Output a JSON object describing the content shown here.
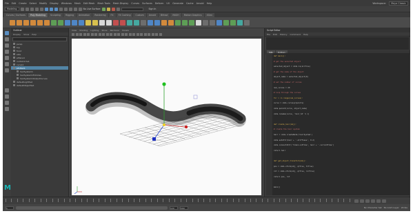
{
  "colors": {
    "app_bg": "#444444",
    "selection": "#5285a6",
    "accent_blue": "#5a8ec2",
    "code_def": "#d8b04e",
    "code_comment": "#c26a6a",
    "maya_logo": "#19b5b5"
  },
  "menubar": {
    "items": [
      "File",
      "Edit",
      "Create",
      "Select",
      "Modify",
      "Display",
      "Windows",
      "Mesh",
      "Edit Mesh",
      "Mesh Tools",
      "Mesh Display",
      "Curves",
      "Surfaces",
      "Deform",
      "UV",
      "Generate",
      "Cache",
      "Arnold",
      "Help"
    ],
    "workspace_label": "Workspace:",
    "workspace_value": "Maya Classic"
  },
  "statusline": {
    "mode": "Modeling",
    "no_live_surface": "No Live Surface",
    "sign_in": "Sign In"
  },
  "shelf_tabs": [
    "Curves / Surfaces",
    "Poly Modeling",
    "Sculpting",
    "Rigging",
    "Animation",
    "Rendering",
    "FX",
    "FX Caching",
    "Custom",
    "Arnold",
    "Bifrost",
    "MASH",
    "Motion Graphics",
    "XGen"
  ],
  "shelf_active_index": 1,
  "toolbox_icons": [
    "select-tool",
    "lasso-tool",
    "paint-select-tool",
    "move-tool",
    "rotate-tool",
    "scale-tool",
    "last-tool"
  ],
  "outliner": {
    "title": "Outliner",
    "menu": [
      "Display",
      "Show",
      "Help"
    ],
    "items": [
      {
        "label": "persp",
        "selected": false
      },
      {
        "label": "top",
        "selected": false
      },
      {
        "label": "front",
        "selected": false
      },
      {
        "label": "side",
        "selected": false
      },
      {
        "label": "pPlane1",
        "selected": false
      },
      {
        "label": "nurbsCircle1",
        "selected": false
      },
      {
        "label": "curve1",
        "selected": false
      },
      {
        "label": "pfxHair1",
        "selected": true
      },
      {
        "label": "hairSystem1",
        "selected": false
      },
      {
        "label": "hairSystem1Follicles",
        "selected": false
      },
      {
        "label": "hairSystem1OutputCurves",
        "selected": false
      },
      {
        "label": "defaultLightSet",
        "selected": false
      },
      {
        "label": "defaultObjectSet",
        "selected": false
      }
    ]
  },
  "viewport": {
    "menu": [
      "View",
      "Shading",
      "Lighting",
      "Show",
      "Renderer",
      "Panels"
    ]
  },
  "script_editor": {
    "title": "Script Editor",
    "menu": [
      "File",
      "Edit",
      "History",
      "Command",
      "Help"
    ],
    "tab": "MEL",
    "tab2": "Python",
    "code_lines": [
      {
        "text": "def main():",
        "kind": "def"
      },
      {
        "text": "    # get the selected object",
        "kind": "com"
      },
      {
        "text": "    selected_object = cmds.ls(sl=True)",
        "kind": "txt"
      },
      {
        "text": "    # get the name of the object",
        "kind": "com"
      },
      {
        "text": "    object_name = selected_object[0]",
        "kind": "txt"
      },
      {
        "text": "    # set the number of curves",
        "kind": "com"
      },
      {
        "text": "    num_curves = 20",
        "kind": "txt"
      },
      {
        "text": "    # loop through the curves",
        "kind": "com"
      },
      {
        "text": "    for i in range(num_curves):",
        "kind": "kw"
      },
      {
        "text": "        curve = cmds.curve(p=points)",
        "kind": "txt"
      },
      {
        "text": "        cmds.parent(curve, object_name)",
        "kind": "txt"
      },
      {
        "text": "        cmds.rename(curve, 'hair_%d' % i)",
        "kind": "txt"
      },
      {
        "text": "",
        "kind": "txt"
      },
      {
        "text": "def create_hair(obj):",
        "kind": "def"
      },
      {
        "text": "    # create the hair system",
        "kind": "com"
      },
      {
        "text": "    hair = cmds.createNode('hairSystem')",
        "kind": "txt"
      },
      {
        "text": "    cmds.setAttr(hair + '.stiffness', 0.2)",
        "kind": "txt"
      },
      {
        "text": "    cmds.connectAttr('time1.outTime', hair + '.currentTime')",
        "kind": "txt"
      },
      {
        "text": "    return hair",
        "kind": "txt"
      },
      {
        "text": "",
        "kind": "txt"
      },
      {
        "text": "def get_object_transform(obj):",
        "kind": "def"
      },
      {
        "text": "    pos = cmds.xform(obj, q=True, t=True)",
        "kind": "txt"
      },
      {
        "text": "    rot = cmds.xform(obj, q=True, ro=True)",
        "kind": "txt"
      },
      {
        "text": "    return pos, rot",
        "kind": "txt"
      },
      {
        "text": "",
        "kind": "txt"
      },
      {
        "text": "main()",
        "kind": "txt"
      }
    ]
  },
  "timeline": {
    "start_frame": "1",
    "end_frame": "120",
    "range_end": "200",
    "char_set": "No Character Set",
    "anim_layer": "No Anim Layer",
    "fps": "24 fps"
  }
}
